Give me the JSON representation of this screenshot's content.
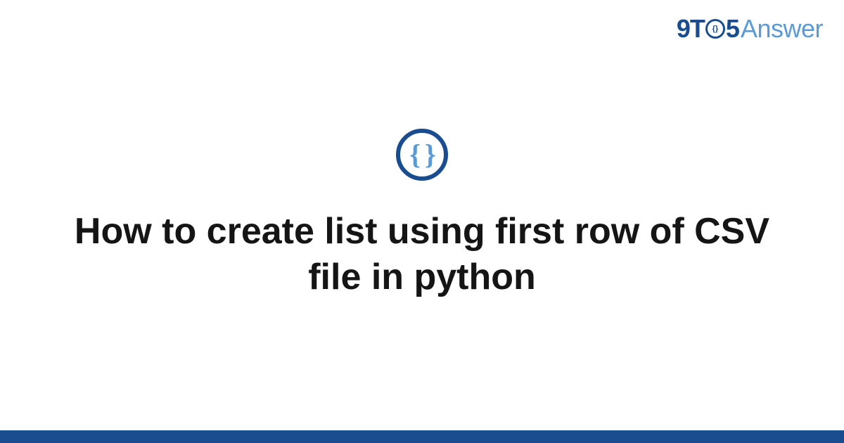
{
  "logo": {
    "part1": "9T",
    "inner_braces": "{}",
    "part2": "5",
    "part3": "Answer"
  },
  "icon": {
    "braces": "{ }"
  },
  "title": "How to create list using first row of CSV file in python",
  "colors": {
    "primary": "#1a4d8f",
    "accent": "#5a9bd5"
  }
}
